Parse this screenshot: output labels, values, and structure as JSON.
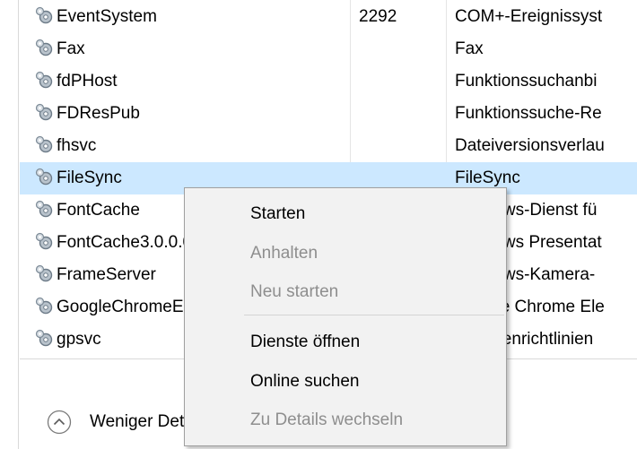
{
  "services": {
    "rows": [
      {
        "name": "EventSystem",
        "pid": "2292",
        "desc": "COM+-Ereignissyst"
      },
      {
        "name": "Fax",
        "pid": "",
        "desc": "Fax"
      },
      {
        "name": "fdPHost",
        "pid": "",
        "desc": "Funktionssuchanbi"
      },
      {
        "name": "FDResPub",
        "pid": "",
        "desc": "Funktionssuche-Re"
      },
      {
        "name": "fhsvc",
        "pid": "",
        "desc": "Dateiversionsverlau"
      },
      {
        "name": "FileSync",
        "pid": "",
        "desc": "FileSync"
      },
      {
        "name": "FontCache",
        "pid": "",
        "desc": "Windows-Dienst fü"
      },
      {
        "name": "FontCache3.0.0.0",
        "pid": "",
        "desc": "Windows Presentat"
      },
      {
        "name": "FrameServer",
        "pid": "",
        "desc": "Windows-Kamera-"
      },
      {
        "name": "GoogleChromeElevationService",
        "pid": "",
        "desc": "Google Chrome Ele"
      },
      {
        "name": "gpsvc",
        "pid": "",
        "desc": "Gruppenrichtlinien"
      }
    ],
    "selected_index": 5
  },
  "footer": {
    "less_details_label": "Weniger Details"
  },
  "context_menu": {
    "items": [
      {
        "label": "Starten",
        "enabled": true
      },
      {
        "label": "Anhalten",
        "enabled": false
      },
      {
        "label": "Neu starten",
        "enabled": false
      },
      {
        "label": "Dienste öffnen",
        "enabled": true
      },
      {
        "label": "Online suchen",
        "enabled": true
      },
      {
        "label": "Zu Details wechseln",
        "enabled": false
      }
    ]
  },
  "colors": {
    "selection": "#cce8ff",
    "menu_background": "#f2f2f2",
    "disabled_text": "#8e8e8e"
  },
  "icons": {
    "service": "gear-service-icon",
    "collapse": "chevron-up-circle-icon"
  }
}
